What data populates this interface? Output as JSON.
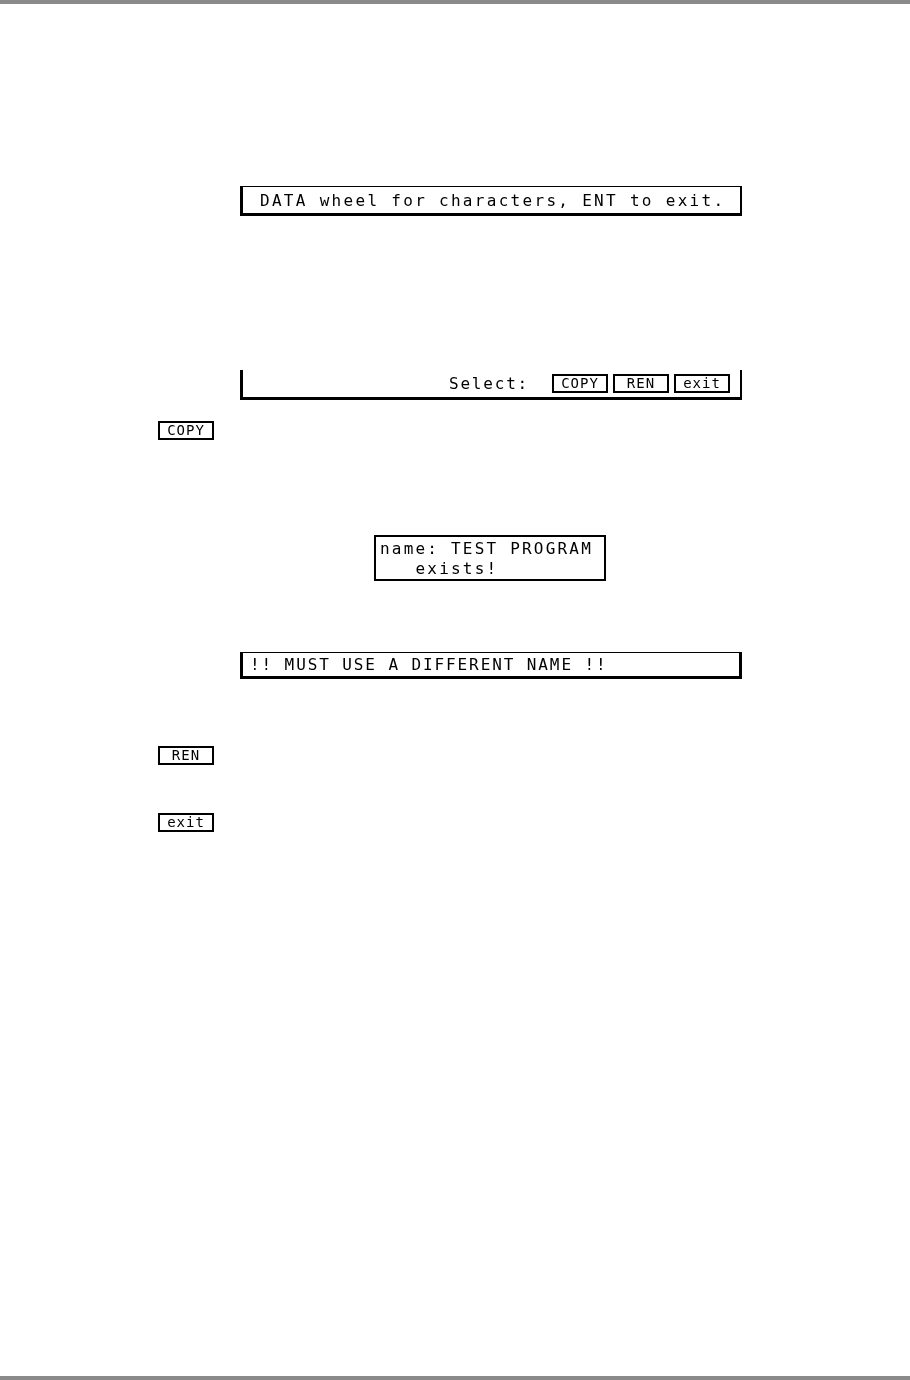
{
  "items": [
    {
      "kind": "bar",
      "text": "DATA wheel for characters, ENT to exit."
    },
    {
      "kind": "softkeys",
      "prompt": "Select:",
      "keys": [
        "COPY",
        "REN",
        "exit"
      ]
    },
    {
      "kind": "key",
      "label": "COPY"
    },
    {
      "kind": "dialog",
      "lines": [
        "name: TEST PROGRAM",
        "   exists!"
      ]
    },
    {
      "kind": "bar",
      "text": "!! MUST USE A DIFFERENT NAME !!"
    },
    {
      "kind": "key",
      "label": "REN"
    },
    {
      "kind": "key",
      "label": "exit"
    }
  ]
}
